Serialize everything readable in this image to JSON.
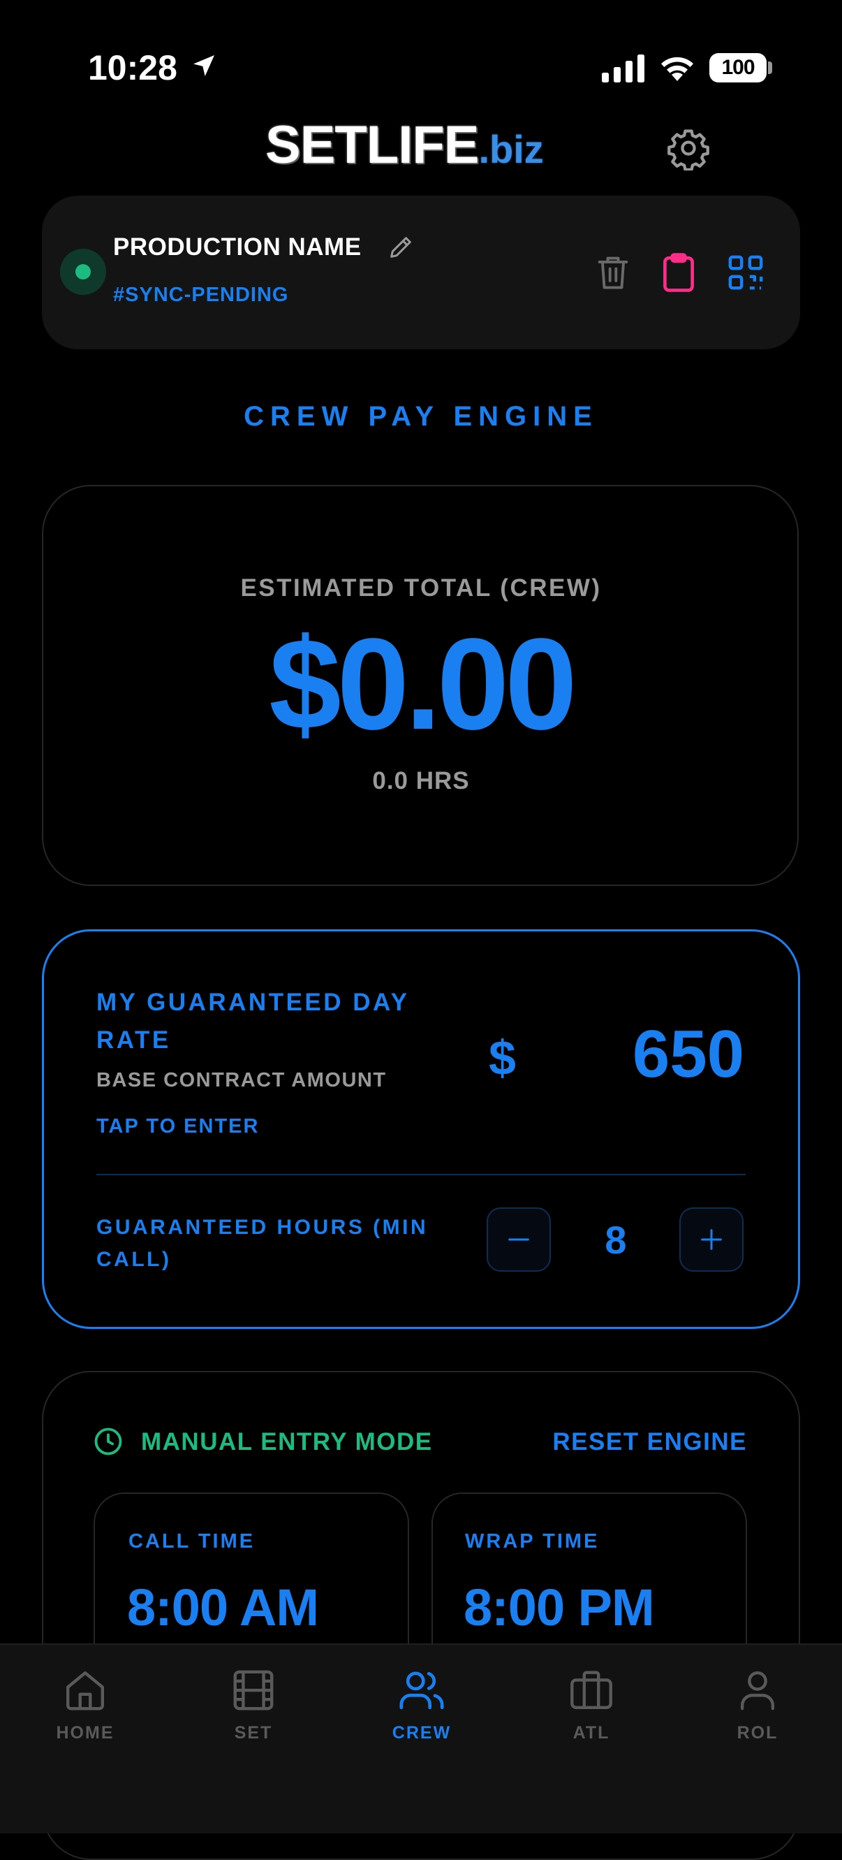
{
  "status_bar": {
    "time": "10:28",
    "battery": "100"
  },
  "header": {
    "logo_main": "SETLIFE",
    "logo_suffix": ".biz"
  },
  "production": {
    "name": "PRODUCTION NAME",
    "tag": "#SYNC-PENDING",
    "status_color": "#1dbb7f",
    "action_icons": [
      "trash-icon",
      "clipboard-icon",
      "qr-code-icon"
    ]
  },
  "engine": {
    "title": "CREW PAY ENGINE",
    "estimate_label": "ESTIMATED TOTAL (CREW)",
    "estimate_total": "$0.00",
    "estimate_hours": "0.0 HRS"
  },
  "rate": {
    "title": "MY GUARANTEED DAY RATE",
    "subtitle": "BASE CONTRACT AMOUNT",
    "tap_hint": "TAP TO ENTER",
    "currency": "$",
    "value": "650",
    "hours_label": "GUARANTEED HOURS (MIN CALL)",
    "hours_value": "8",
    "minus": "−",
    "plus": "+"
  },
  "manual": {
    "mode_label": "MANUAL ENTRY MODE",
    "reset_label": "RESET ENGINE",
    "call_label": "CALL TIME",
    "call_value": "8:00 AM",
    "wrap_label": "WRAP TIME",
    "wrap_value": "8:00 PM"
  },
  "nav": {
    "active": "CREW",
    "items": [
      {
        "label": "HOME",
        "icon": "home-icon"
      },
      {
        "label": "SET",
        "icon": "film-icon"
      },
      {
        "label": "CREW",
        "icon": "users-icon"
      },
      {
        "label": "ATL",
        "icon": "briefcase-icon"
      },
      {
        "label": "ROL",
        "icon": "user-icon"
      }
    ]
  },
  "colors": {
    "accent": "#1a7ff0",
    "success": "#1dbb7f",
    "highlight": "#ff2d8a",
    "muted": "#9a9a9a",
    "background": "#000000"
  }
}
